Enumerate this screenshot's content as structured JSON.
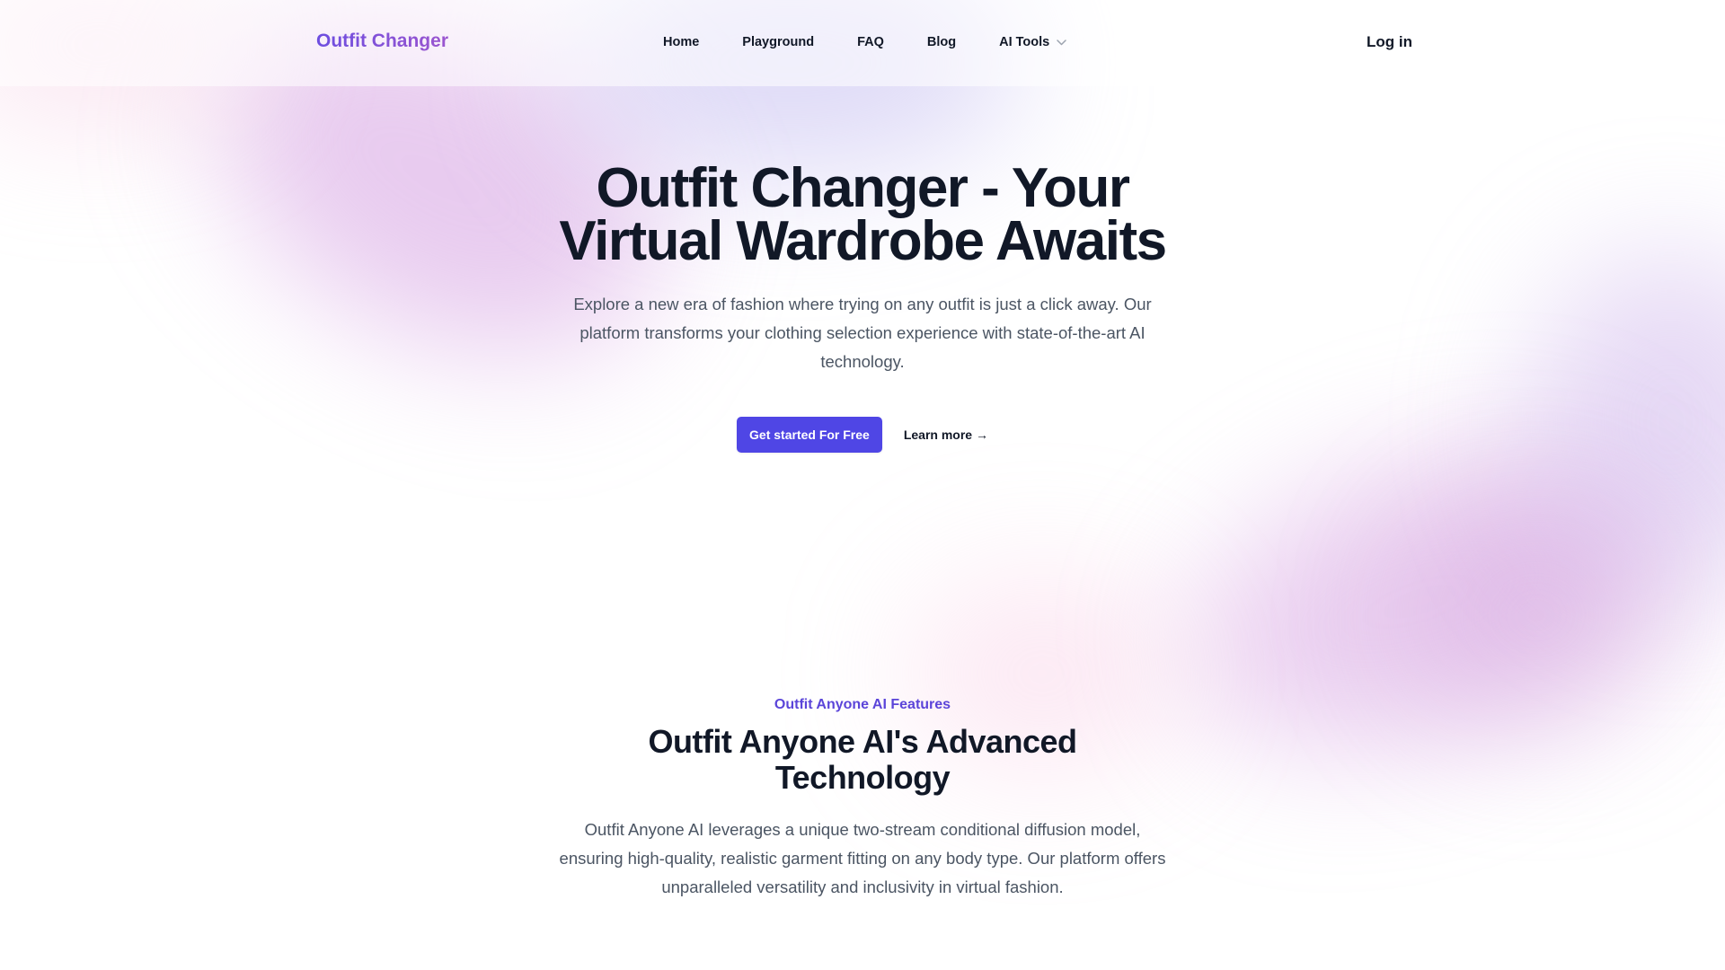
{
  "header": {
    "logo": "Outfit Changer",
    "nav": {
      "home": "Home",
      "playground": "Playground",
      "faq": "FAQ",
      "blog": "Blog",
      "ai_tools": "AI Tools"
    },
    "login": "Log in",
    "chevron_icon": "chevron-down-icon"
  },
  "hero": {
    "title": "Outfit Changer - Your Virtual Wardrobe Awaits",
    "description": "Explore a new era of fashion where trying on any outfit is just a click away. Our platform transforms your clothing selection experience with state-of-the-art AI technology.",
    "primary_button": "Get started For Free",
    "secondary_button": "Learn more →"
  },
  "features": {
    "eyebrow": "Outfit Anyone AI Features",
    "title": "Outfit Anyone AI's Advanced Technology",
    "description": "Outfit Anyone AI leverages a unique two-stream conditional diffusion model, ensuring high-quality, realistic garment fitting on any body type. Our platform offers unparalleled versatility and inclusivity in virtual fashion."
  },
  "colors": {
    "brand": "#4f46e5",
    "logo_gradient_start": "#6d4ee0",
    "logo_gradient_end": "#9b55cf",
    "eyebrow": "#5b45d9",
    "heading": "#111827",
    "body_text": "#4b5563"
  }
}
